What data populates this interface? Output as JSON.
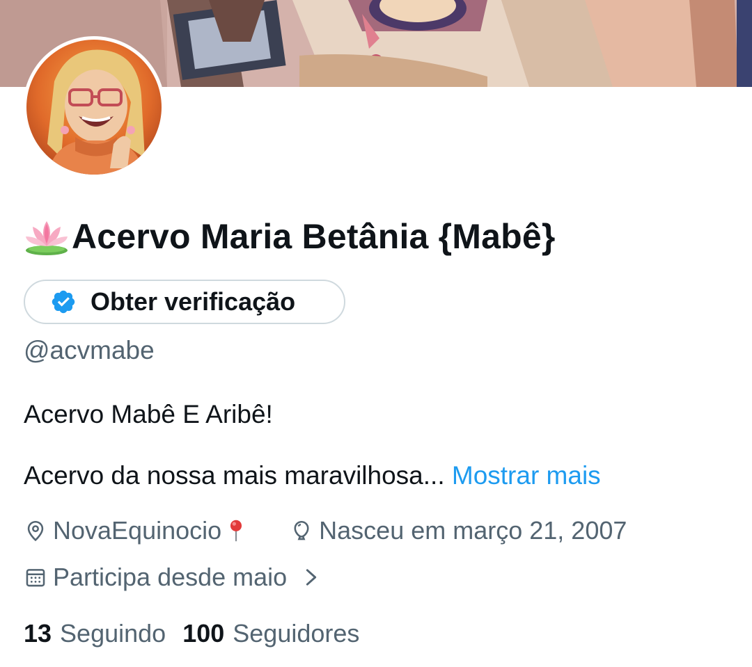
{
  "profile": {
    "display_name": "Acervo Maria Betânia {Mabê}",
    "name_emoji": "lotus-icon",
    "handle": "@acvmabe",
    "bio_line1": "Acervo Mabê E Aribê!",
    "bio_line2": "Acervo da nossa mais maravilhosa...",
    "show_more": "Mostrar mais",
    "location": "NovaEquinocio",
    "birthday": "Nasceu em março 21, 2007",
    "joined": "Participa desde maio"
  },
  "verify_button": {
    "label": "Obter verificação",
    "icon": "verified-badge-icon"
  },
  "stats": {
    "following_count": "13",
    "following_label": "Seguindo",
    "followers_count": "100",
    "followers_label": "Seguidores"
  },
  "colors": {
    "text_primary": "#0f1419",
    "text_secondary": "#536471",
    "link": "#1d9bf0",
    "border": "#cfd9de"
  }
}
